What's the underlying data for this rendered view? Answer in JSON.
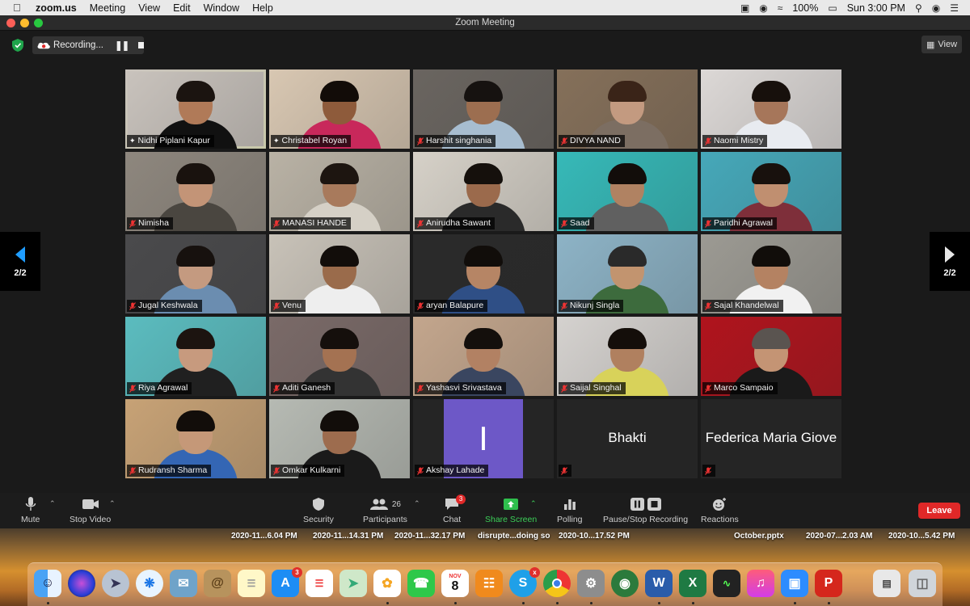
{
  "menubar": {
    "app": "zoom.us",
    "items": [
      "Meeting",
      "View",
      "Edit",
      "Window",
      "Help"
    ],
    "battery": "100%",
    "clock": "Sun 3:00 PM"
  },
  "window": {
    "title": "Zoom Meeting"
  },
  "recording": {
    "label": "Recording..."
  },
  "view_button": {
    "label": "View"
  },
  "pager": {
    "left": "2/2",
    "right": "2/2"
  },
  "participants": [
    {
      "name": "Nidhi Piplani Kapur",
      "muted": false,
      "pinned": true,
      "active": true,
      "bg": "#c9c3bd",
      "skin": "#b07a58",
      "hair": "#1b1410",
      "shirt": "#111111"
    },
    {
      "name": "Christabel Royan",
      "muted": false,
      "pinned": true,
      "bg": "#d8c7b2",
      "skin": "#8e5b3b",
      "hair": "#120c08",
      "shirt": "#c8285b"
    },
    {
      "name": "Harshit singhania",
      "muted": true,
      "bg": "#6a6560",
      "skin": "#9c6e50",
      "hair": "#161210",
      "shirt": "#a7bdd0"
    },
    {
      "name": "DIVYA NAND",
      "muted": true,
      "bg": "#85705a",
      "skin": "#c39a80",
      "hair": "#3a2418",
      "shirt": "#7c6e62"
    },
    {
      "name": "Naomi Mistry",
      "muted": true,
      "bg": "#dcd8d6",
      "skin": "#a6765a",
      "hair": "#17100c",
      "shirt": "#e8ebf0"
    },
    {
      "name": "Nimisha",
      "muted": true,
      "bg": "#8e877e",
      "skin": "#c39477",
      "hair": "#19120e",
      "shirt": "#4a4640"
    },
    {
      "name": "MANASI HANDE",
      "muted": true,
      "bg": "#b9b2a5",
      "skin": "#a87a5c",
      "hair": "#1d1510",
      "shirt": "#d5d0c6"
    },
    {
      "name": "Anirudha Sawant",
      "muted": true,
      "bg": "#d6d1c8",
      "skin": "#9b6a4c",
      "hair": "#15100c",
      "shirt": "#2a2a2a"
    },
    {
      "name": "Saad",
      "muted": true,
      "bg": "#36b9b8",
      "skin": "#b08262",
      "hair": "#120d0a",
      "shirt": "#606060"
    },
    {
      "name": "Paridhi Agrawal",
      "muted": true,
      "bg": "#46a8b9",
      "skin": "#c08f70",
      "hair": "#18110d",
      "shirt": "#7e2f3a"
    },
    {
      "name": "Jugal Keshwala",
      "muted": true,
      "bg": "#4a4a4c",
      "skin": "#c49a80",
      "hair": "#17110e",
      "shirt": "#6b8db0"
    },
    {
      "name": "Venu",
      "muted": true,
      "bg": "#c8c2b8",
      "skin": "#9a6b4b",
      "hair": "#120d0a",
      "shirt": "#eeeeee"
    },
    {
      "name": "aryan Balapure",
      "muted": true,
      "bg": "#2a2a2a",
      "skin": "#b68565",
      "hair": "#110d0a",
      "shirt": "#2f4f86"
    },
    {
      "name": "Nikunj Singla",
      "muted": true,
      "bg": "#8db3c6",
      "skin": "#c2946f",
      "hair": "#2a2a2a",
      "shirt": "#3d6b3d"
    },
    {
      "name": "Sajal Khandelwal",
      "muted": true,
      "bg": "#9c9a93",
      "skin": "#b48262",
      "hair": "#110d0a",
      "shirt": "#f1f1f1"
    },
    {
      "name": "Riya Agrawal",
      "muted": true,
      "bg": "#5bbcbf",
      "skin": "#c79a7e",
      "hair": "#1c1410",
      "shirt": "#202020"
    },
    {
      "name": "Aditi Ganesh",
      "muted": true,
      "bg": "#7a6a68",
      "skin": "#a47252",
      "hair": "#150f0c",
      "shirt": "#333333"
    },
    {
      "name": "Yashasvi Srivastava",
      "muted": true,
      "bg": "#c3a68d",
      "skin": "#b28163",
      "hair": "#140f0c",
      "shirt": "#3a4660"
    },
    {
      "name": "Saijal Singhal",
      "muted": true,
      "bg": "#d5d2cf",
      "skin": "#b0805f",
      "hair": "#140e0a",
      "shirt": "#d8d25a"
    },
    {
      "name": "Marco Sampaio",
      "muted": true,
      "bg": "#b0141d",
      "skin": "#c49474",
      "hair": "#5a5450",
      "shirt": "#1a1a1a"
    },
    {
      "name": "Rudransh Sharma",
      "muted": true,
      "bg": "#c7a276",
      "skin": "#c59878",
      "hair": "#120d0a",
      "shirt": "#3466b4"
    },
    {
      "name": "Omkar Kulkarni",
      "muted": true,
      "bg": "#b6bab3",
      "skin": "#9d6c4e",
      "hair": "#120d0a",
      "shirt": "#1a1a1a"
    },
    {
      "name": "Akshay Lahade",
      "muted": true,
      "initial": "I"
    },
    {
      "name": "Bhakti",
      "muted": true,
      "video_off": true
    },
    {
      "name": "Federica Maria Giove",
      "muted": true,
      "video_off": true
    }
  ],
  "toolbar": {
    "mute": "Mute",
    "stop_video": "Stop Video",
    "security": "Security",
    "participants": "Participants",
    "participants_count": "26",
    "chat": "Chat",
    "chat_badge": "3",
    "share_screen": "Share Screen",
    "polling": "Polling",
    "pause_stop_recording": "Pause/Stop Recording",
    "reactions": "Reactions",
    "leave": "Leave"
  },
  "desktop_files": [
    "2020-11...6.04 PM",
    "2020-11...14.31 PM",
    "2020-11...32.17 PM",
    "disrupte...doing so",
    "2020-10...17.52 PM",
    "October.pptx",
    "2020-07...2.03 AM",
    "2020-10...5.42 PM"
  ],
  "dock": {
    "appstore_badge": "3",
    "calendar_month": "NOV",
    "calendar_day": "8",
    "skype_badge": "x"
  }
}
